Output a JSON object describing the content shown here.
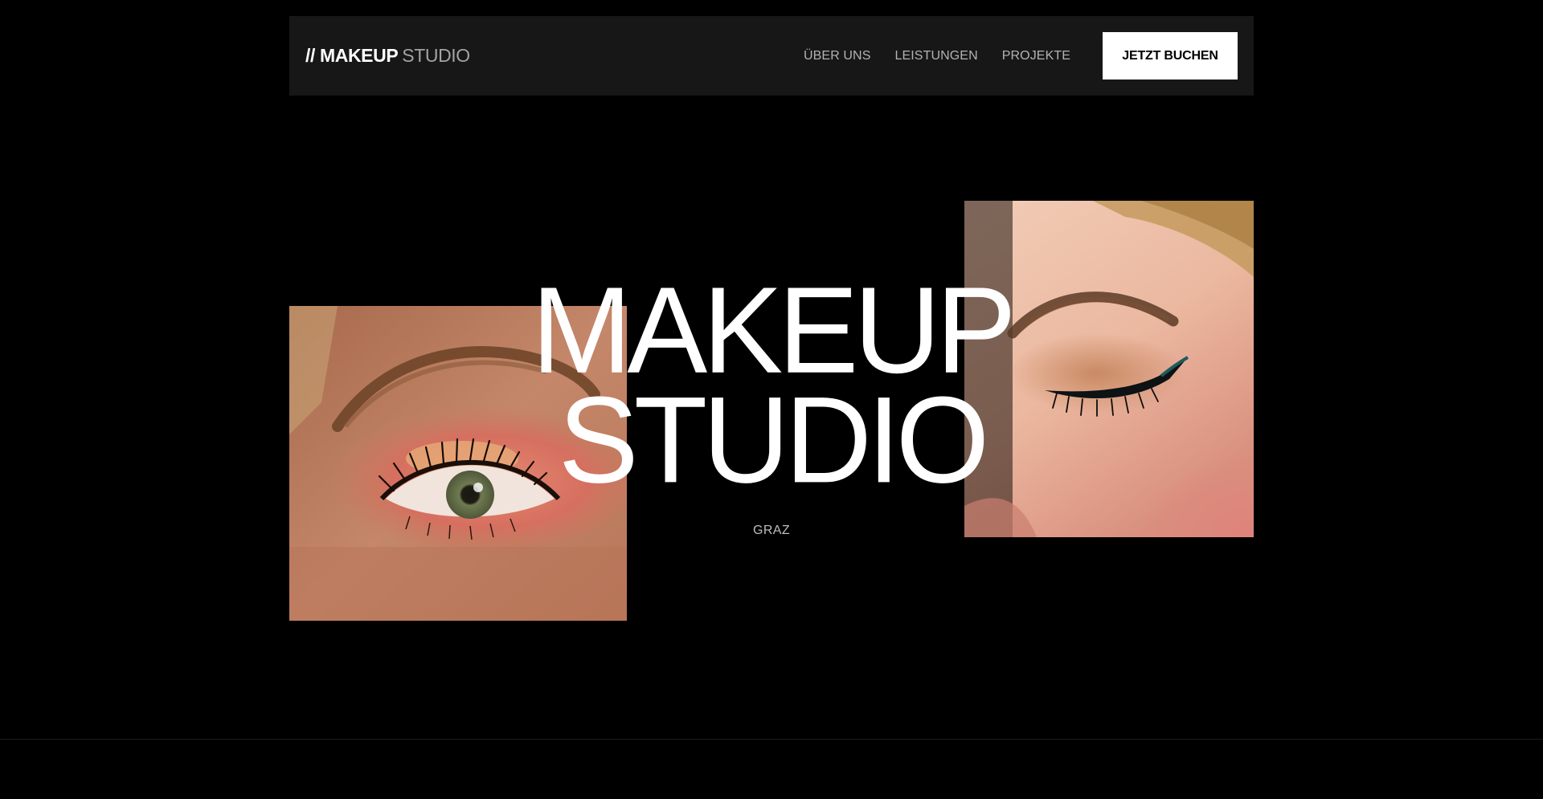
{
  "header": {
    "logo": {
      "prefix": "//",
      "strong": "MAKEUP",
      "light": "STUDIO"
    },
    "nav": [
      {
        "label": "ÜBER UNS"
      },
      {
        "label": "LEISTUNGEN"
      },
      {
        "label": "PROJEKTE"
      }
    ],
    "cta_label": "JETZT BUCHEN"
  },
  "hero": {
    "title_line1": "MAKEUP",
    "title_line2": "STUDIO",
    "city": "GRAZ",
    "images": [
      {
        "name": "eye-closeup-pink-eyeshadow",
        "tone": "#b8765a"
      },
      {
        "name": "face-closeup-winged-eyeliner",
        "tone": "#eab9a3"
      }
    ]
  },
  "colors": {
    "background": "#000000",
    "navbar": "#171717",
    "cta_background": "#ffffff",
    "muted_text": "#b3b3b3"
  }
}
